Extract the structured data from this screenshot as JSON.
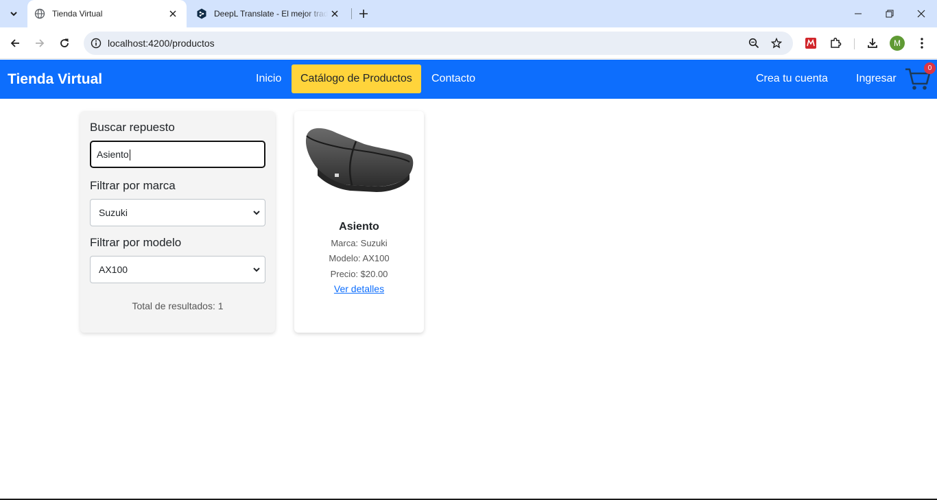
{
  "browser": {
    "tabs": [
      {
        "title": "Tienda Virtual",
        "active": true
      },
      {
        "title": "DeepL Translate - El mejor traductor",
        "active": false
      }
    ],
    "url": "localhost:4200/productos",
    "profile_initial": "M"
  },
  "nav": {
    "brand": "Tienda Virtual",
    "links": [
      "Inicio",
      "Catálogo de Productos",
      "Contacto"
    ],
    "active_link": "Catálogo de Productos",
    "right_links": [
      "Crea tu cuenta",
      "Ingresar"
    ],
    "cart_count": "0"
  },
  "filters": {
    "search_label": "Buscar repuesto",
    "search_value": "Asiento",
    "brand_label": "Filtrar por marca",
    "brand_selected": "Suzuki",
    "model_label": "Filtrar por modelo",
    "model_selected": "AX100",
    "total": "Total de resultados: 1"
  },
  "products": [
    {
      "name": "Asiento",
      "brand": "Marca: Suzuki",
      "model": "Modelo: AX100",
      "price": "Precio: $20.00",
      "link": "Ver detalles"
    }
  ],
  "colors": {
    "nav_bg": "#0d6efd",
    "active_link_bg": "#ffd43b",
    "badge": "#dc3545",
    "tabstrip": "#d3e3fd"
  }
}
